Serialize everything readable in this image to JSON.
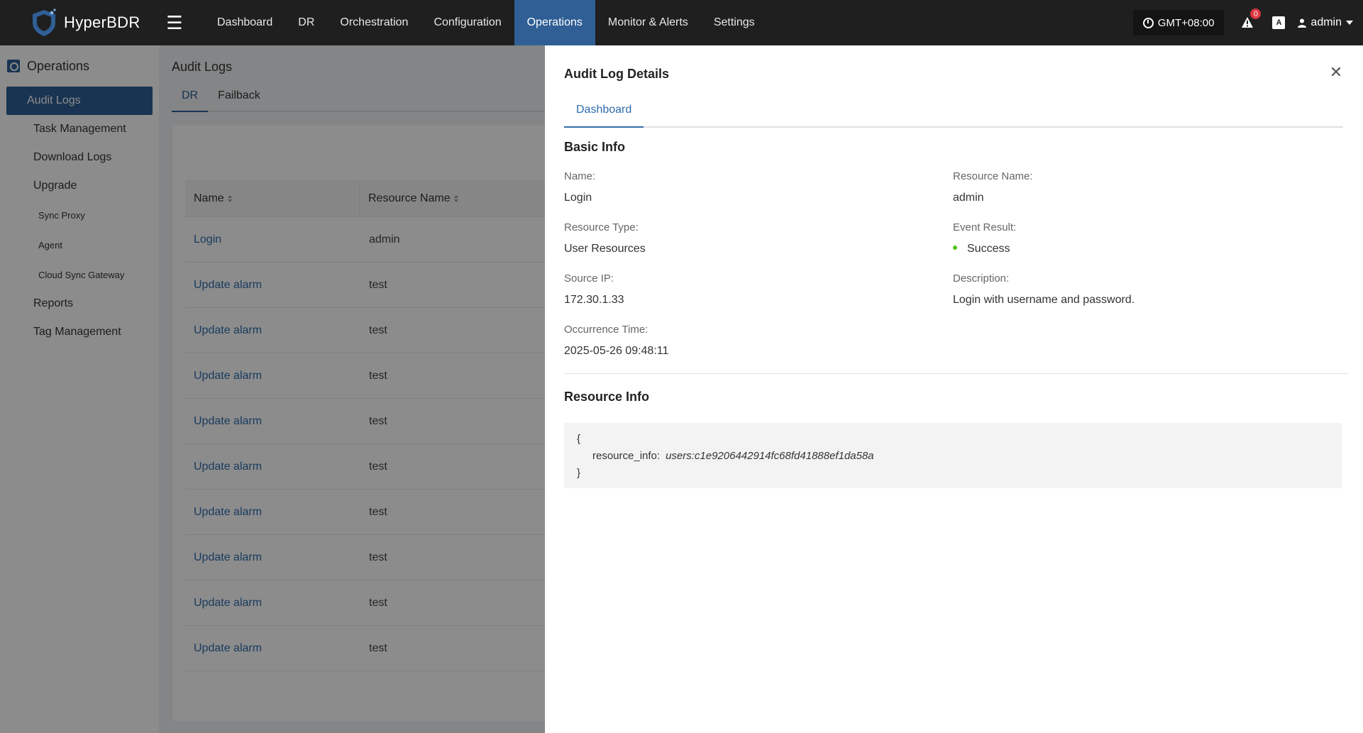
{
  "app": {
    "name": "HyperBDR"
  },
  "topnav": {
    "items": [
      "Dashboard",
      "DR",
      "Orchestration",
      "Configuration",
      "Operations",
      "Monitor & Alerts",
      "Settings"
    ],
    "active": "Operations",
    "timezone": "GMT+08:00",
    "alert_count": "0",
    "lang_icon": "A",
    "user": "admin"
  },
  "sidebar": {
    "section": "Operations",
    "items": [
      {
        "label": "Audit Logs"
      },
      {
        "label": "Task Management"
      },
      {
        "label": "Download Logs"
      },
      {
        "label": "Upgrade"
      },
      {
        "label": "Sync Proxy"
      },
      {
        "label": "Agent"
      },
      {
        "label": "Cloud Sync Gateway"
      },
      {
        "label": "Reports"
      },
      {
        "label": "Tag Management"
      }
    ]
  },
  "page": {
    "title": "Audit Logs",
    "tabs": [
      "DR",
      "Failback"
    ]
  },
  "table": {
    "columns": [
      "Name",
      "Resource Name"
    ],
    "rows": [
      [
        "Login",
        "admin"
      ],
      [
        "Update alarm",
        "test"
      ],
      [
        "Update alarm",
        "test"
      ],
      [
        "Update alarm",
        "test"
      ],
      [
        "Update alarm",
        "test"
      ],
      [
        "Update alarm",
        "test"
      ],
      [
        "Update alarm",
        "test"
      ],
      [
        "Update alarm",
        "test"
      ],
      [
        "Update alarm",
        "test"
      ],
      [
        "Update alarm",
        "test"
      ]
    ]
  },
  "drawer": {
    "title": "Audit Log Details",
    "tab": "Dashboard",
    "basic_info_title": "Basic Info",
    "fields": {
      "name_label": "Name:",
      "name_value": "Login",
      "resource_name_label": "Resource Name:",
      "resource_name_value": "admin",
      "resource_type_label": "Resource Type:",
      "resource_type_value": "User Resources",
      "event_result_label": "Event Result:",
      "event_result_value": "Success",
      "source_ip_label": "Source IP:",
      "source_ip_value": "172.30.1.33",
      "description_label": "Description:",
      "description_value": "Login with username and password.",
      "occurrence_time_label": "Occurrence Time:",
      "occurrence_time_value": "2025-05-26 09:48:11"
    },
    "resource_info_title": "Resource Info",
    "code": {
      "open": "{",
      "key": "resource_info:",
      "value": "users:c1e9206442914fc68fd41888ef1da58a",
      "close": "}"
    },
    "status_color": "#52c41a"
  }
}
